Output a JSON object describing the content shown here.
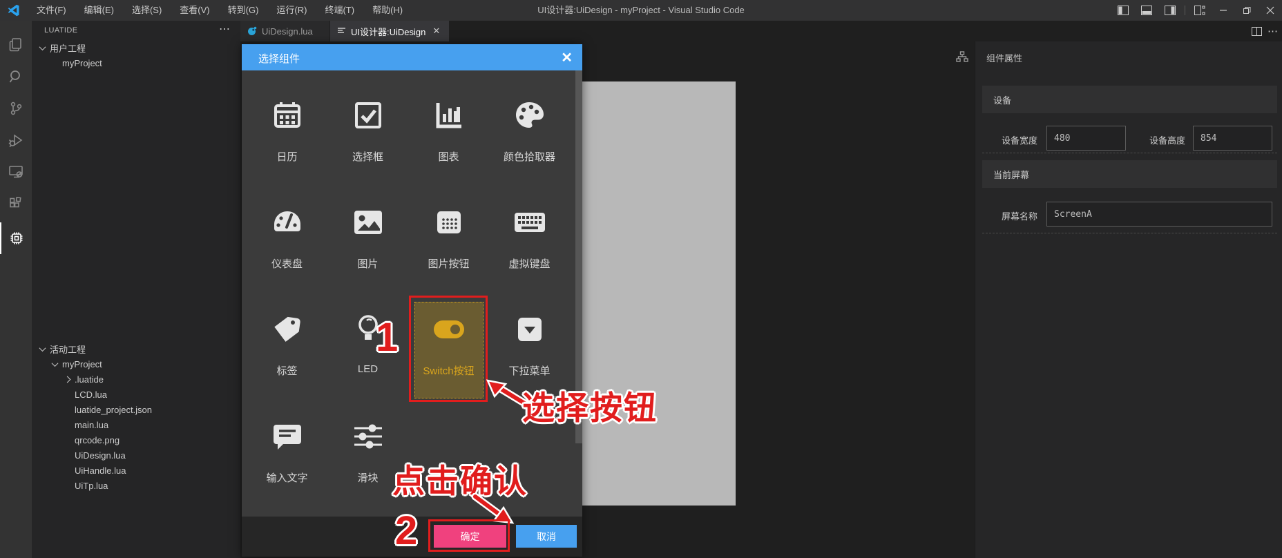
{
  "window": {
    "title": "UI设计器:UiDesign - myProject - Visual Studio Code"
  },
  "menu_bar": {
    "items": [
      "文件(F)",
      "编辑(E)",
      "选择(S)",
      "查看(V)",
      "转到(G)",
      "运行(R)",
      "终端(T)",
      "帮助(H)"
    ]
  },
  "activity_bar": {
    "items": [
      {
        "name": "explorer"
      },
      {
        "name": "search"
      },
      {
        "name": "source-control"
      },
      {
        "name": "run-debug"
      },
      {
        "name": "remote-explorer"
      },
      {
        "name": "extensions"
      },
      {
        "name": "luatide",
        "active": true
      }
    ]
  },
  "sidebar": {
    "title": "LUATIDE",
    "tree": [
      {
        "label": "用户工程"
      },
      {
        "label": "myProject"
      },
      {
        "label": "活动工程"
      },
      {
        "label": "myProject"
      },
      {
        "label": ".luatide"
      },
      {
        "label": "LCD.lua"
      },
      {
        "label": "luatide_project.json"
      },
      {
        "label": "main.lua"
      },
      {
        "label": "qrcode.png"
      },
      {
        "label": "UiDesign.lua"
      },
      {
        "label": "UiHandle.lua"
      },
      {
        "label": "UiTp.lua"
      }
    ]
  },
  "editor": {
    "tabs": [
      {
        "label": "UiDesign.lua"
      },
      {
        "label": "UI设计器:UiDesign",
        "active": true
      }
    ]
  },
  "modal": {
    "title": "选择组件",
    "components": [
      {
        "label": "日历",
        "icon": "calendar-icon"
      },
      {
        "label": "选择框",
        "icon": "checkbox-icon"
      },
      {
        "label": "图表",
        "icon": "chart-icon"
      },
      {
        "label": "颜色拾取器",
        "icon": "color-picker-icon"
      },
      {
        "label": "仪表盘",
        "icon": "gauge-icon"
      },
      {
        "label": "图片",
        "icon": "image-icon"
      },
      {
        "label": "图片按钮",
        "icon": "image-button-icon"
      },
      {
        "label": "虚拟键盘",
        "icon": "keyboard-icon"
      },
      {
        "label": "标签",
        "icon": "tag-icon"
      },
      {
        "label": "LED",
        "icon": "led-icon"
      },
      {
        "label": "Switch按钮",
        "icon": "switch-icon",
        "selected": true
      },
      {
        "label": "下拉菜单",
        "icon": "dropdown-icon"
      },
      {
        "label": "输入文字",
        "icon": "text-input-icon"
      },
      {
        "label": "滑块",
        "icon": "slider-icon"
      }
    ],
    "ok_label": "确定",
    "cancel_label": "取消"
  },
  "annotations": {
    "step1": "1",
    "step2": "2",
    "select_label": "选择按钮",
    "confirm_label": "点击确认"
  },
  "properties_panel": {
    "title": "组件属性",
    "sections": [
      {
        "title": "设备",
        "fields": [
          {
            "label": "设备宽度",
            "value": "480"
          },
          {
            "label": "设备高度",
            "value": "854"
          }
        ]
      },
      {
        "title": "当前屏幕",
        "fields": [
          {
            "label": "屏幕名称",
            "value": "ScreenA"
          }
        ]
      }
    ]
  },
  "colors": {
    "modal_header_blue": "#47a0ef",
    "confirm_pink": "#f0417e",
    "cancel_blue": "#47a0ef",
    "selected_gold": "#d9a51d",
    "annotation_red": "#e11d1d",
    "canvas_gray": "#b8b8b8"
  }
}
